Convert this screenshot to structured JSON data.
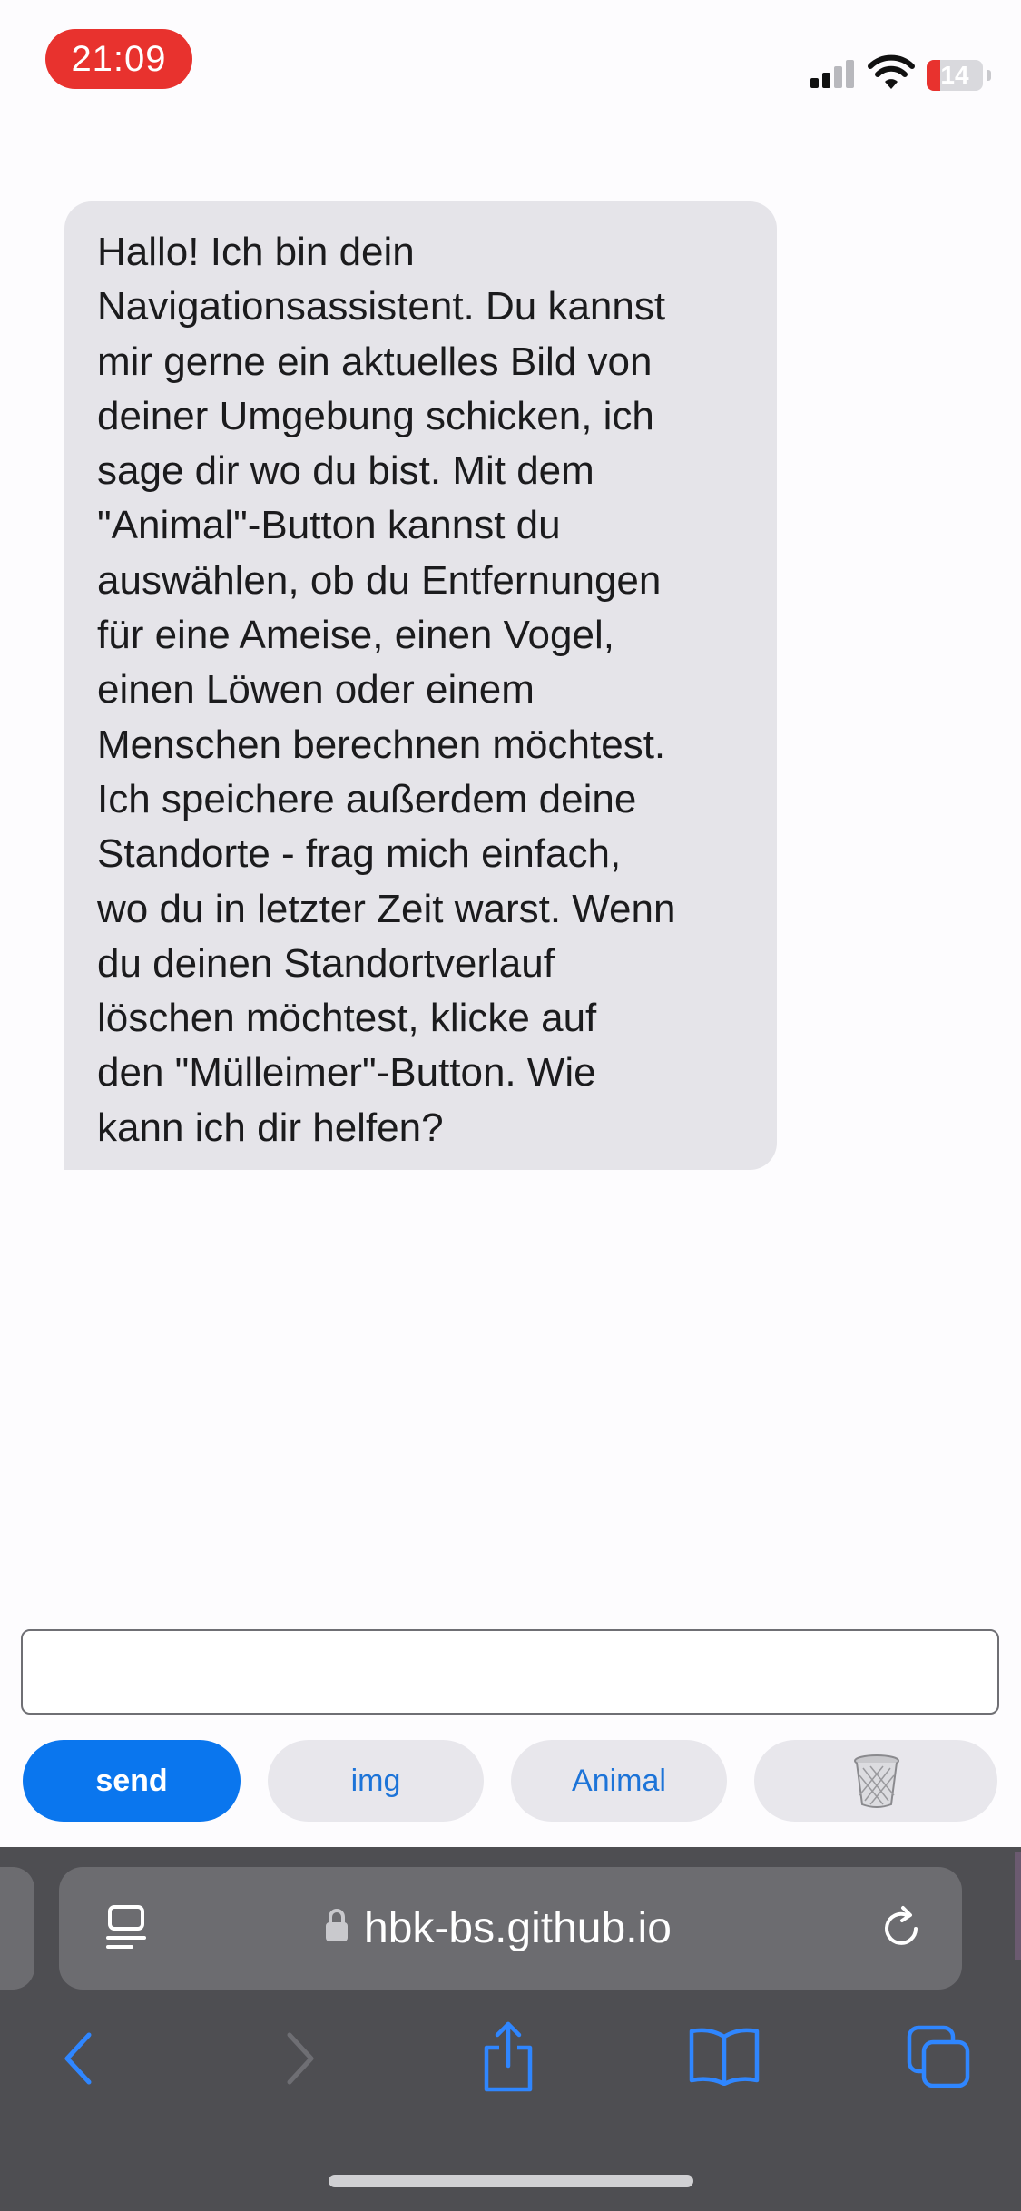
{
  "status_bar": {
    "time": "21:09",
    "battery_level": "14",
    "icons": [
      "cellular-signal-icon",
      "wifi-icon",
      "battery-icon"
    ]
  },
  "chat": {
    "messages": [
      {
        "sender": "assistant",
        "text": "Hallo! Ich bin dein\nNavigationsassistent. Du kannst\nmir gerne ein aktuelles Bild von\ndeiner Umgebung schicken, ich\nsage dir wo du bist. Mit dem\n\"Animal\"-Button kannst du\nauswählen, ob du Entfernungen\nfür eine Ameise, einen Vogel,\neinen Löwen oder einem\nMenschen berechnen möchtest.\nIch speichere außerdem deine\nStandorte - frag mich einfach,\nwo du in letzter Zeit warst. Wenn\ndu deinen Standortverlauf\nlöschen möchtest, klicke auf\nden \"Mülleimer\"-Button. Wie\nkann ich dir helfen?"
      }
    ]
  },
  "input": {
    "value": "",
    "placeholder": ""
  },
  "buttons": {
    "send": "send",
    "img": "img",
    "animal": "Animal",
    "trash_icon": "wastebasket-icon"
  },
  "browser": {
    "url": "hbk-bs.github.io",
    "toolbar_icons": [
      "back-icon",
      "forward-icon",
      "share-icon",
      "bookmarks-icon",
      "tabs-icon"
    ]
  },
  "colors": {
    "accent": "#0a76ee",
    "time_pill": "#e8322e",
    "bubble": "#e5e4e9",
    "toolbar": "#4e4e52"
  }
}
